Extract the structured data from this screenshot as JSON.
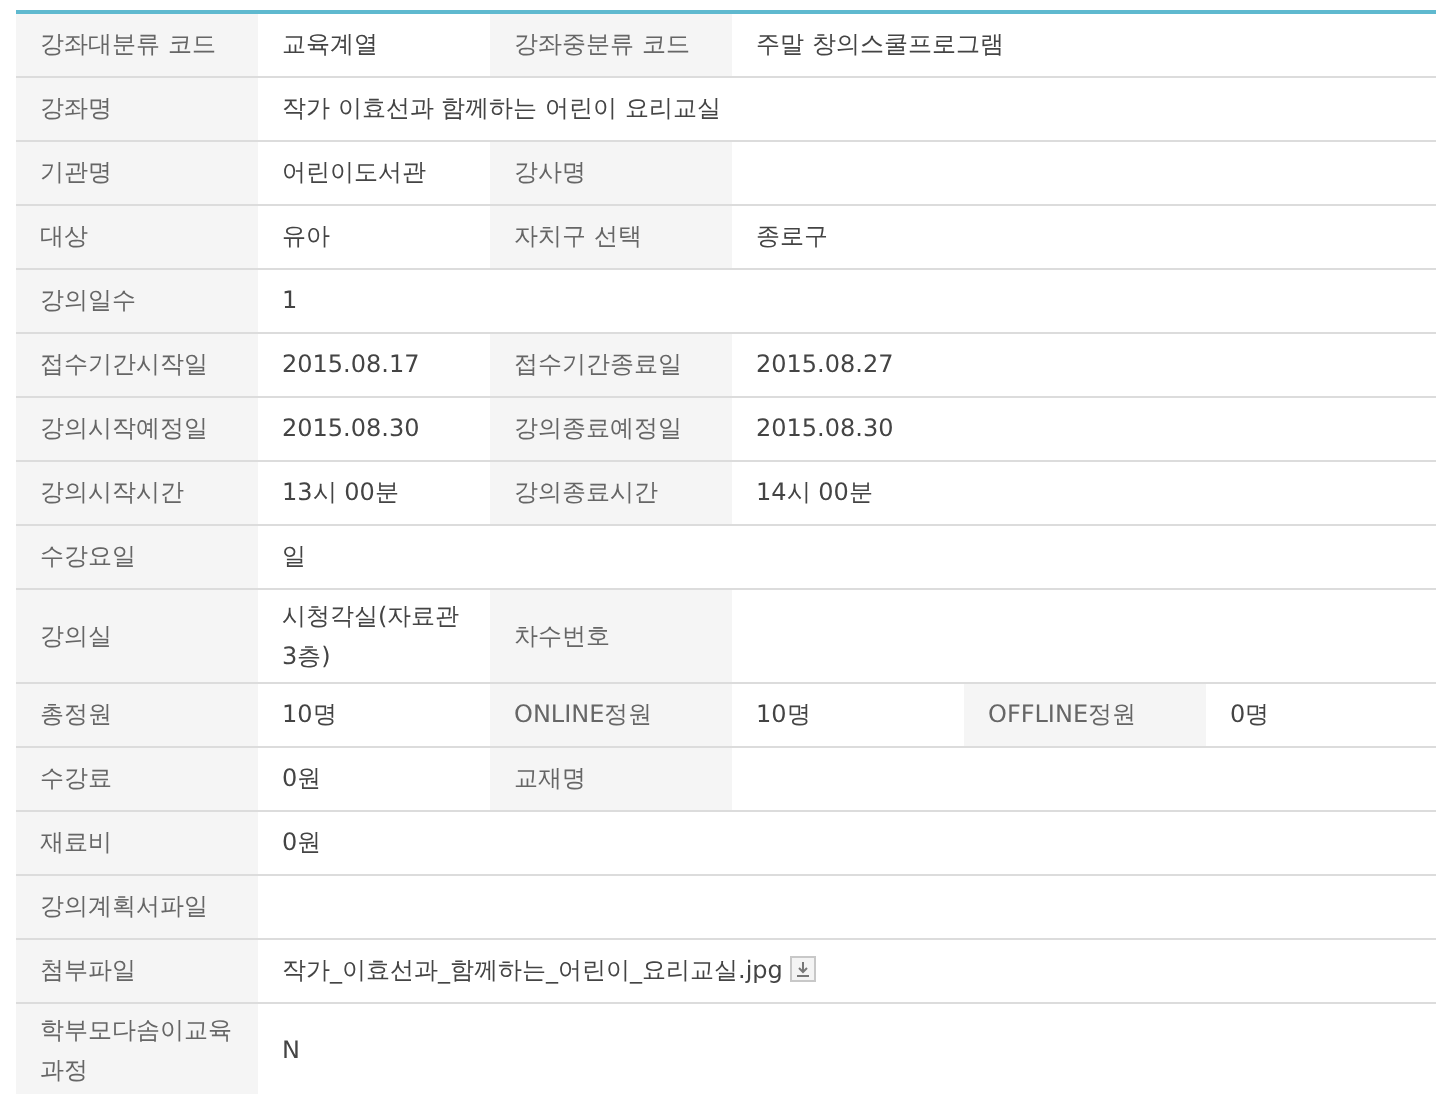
{
  "rows": [
    {
      "cells": [
        {
          "kind": "label",
          "text": "강좌대분류 코드"
        },
        {
          "kind": "value",
          "text": "교육계열"
        },
        {
          "kind": "label",
          "text": "강좌중분류 코드"
        },
        {
          "kind": "value",
          "text": "주말 창의스쿨프로그램"
        }
      ]
    },
    {
      "cells": [
        {
          "kind": "label",
          "text": "강좌명"
        },
        {
          "kind": "value",
          "text": "작가 이효선과 함께하는 어린이 요리교실"
        }
      ]
    },
    {
      "cells": [
        {
          "kind": "label",
          "text": "기관명"
        },
        {
          "kind": "value",
          "text": "어린이도서관"
        },
        {
          "kind": "label",
          "text": "강사명"
        },
        {
          "kind": "value",
          "text": ""
        }
      ]
    },
    {
      "cells": [
        {
          "kind": "label",
          "text": "대상"
        },
        {
          "kind": "value",
          "text": "유아"
        },
        {
          "kind": "label",
          "text": "자치구 선택"
        },
        {
          "kind": "value",
          "text": "종로구"
        }
      ]
    },
    {
      "cells": [
        {
          "kind": "label",
          "text": "강의일수"
        },
        {
          "kind": "value",
          "text": "1"
        }
      ]
    },
    {
      "cells": [
        {
          "kind": "label",
          "text": "접수기간시작일"
        },
        {
          "kind": "value",
          "text": "2015.08.17"
        },
        {
          "kind": "label",
          "text": "접수기간종료일"
        },
        {
          "kind": "value",
          "text": "2015.08.27"
        }
      ]
    },
    {
      "cells": [
        {
          "kind": "label",
          "text": "강의시작예정일"
        },
        {
          "kind": "value",
          "text": "2015.08.30"
        },
        {
          "kind": "label",
          "text": "강의종료예정일"
        },
        {
          "kind": "value",
          "text": "2015.08.30"
        }
      ]
    },
    {
      "cells": [
        {
          "kind": "label",
          "text": "강의시작시간"
        },
        {
          "kind": "value",
          "text": "13시 00분"
        },
        {
          "kind": "label",
          "text": "강의종료시간"
        },
        {
          "kind": "value",
          "text": "14시 00분"
        }
      ]
    },
    {
      "cells": [
        {
          "kind": "label",
          "text": "수강요일"
        },
        {
          "kind": "value",
          "text": "일"
        }
      ]
    },
    {
      "cells": [
        {
          "kind": "label",
          "text": "강의실"
        },
        {
          "kind": "value",
          "text": "시청각실(자료관3층)"
        },
        {
          "kind": "label",
          "text": "차수번호"
        },
        {
          "kind": "value",
          "text": ""
        }
      ]
    },
    {
      "cells": [
        {
          "kind": "label",
          "text": "총정원"
        },
        {
          "kind": "value",
          "text": "10명"
        },
        {
          "kind": "label",
          "text": "ONLINE정원"
        },
        {
          "kind": "value",
          "text": "10명"
        },
        {
          "kind": "label",
          "text": "OFFLINE정원"
        },
        {
          "kind": "value",
          "text": "0명"
        }
      ]
    },
    {
      "cells": [
        {
          "kind": "label",
          "text": "수강료"
        },
        {
          "kind": "value",
          "text": "0원"
        },
        {
          "kind": "label",
          "text": "교재명"
        },
        {
          "kind": "value",
          "text": ""
        }
      ]
    },
    {
      "cells": [
        {
          "kind": "label",
          "text": "재료비"
        },
        {
          "kind": "value",
          "text": "0원"
        }
      ]
    },
    {
      "cells": [
        {
          "kind": "label",
          "text": "강의계획서파일"
        },
        {
          "kind": "value",
          "text": ""
        }
      ]
    },
    {
      "cells": [
        {
          "kind": "label",
          "text": "첨부파일"
        },
        {
          "kind": "file",
          "text": "작가_이효선과_함께하는_어린이_요리교실.jpg"
        }
      ]
    },
    {
      "cells": [
        {
          "kind": "label",
          "text": "학부모다솜이교육과정"
        },
        {
          "kind": "value",
          "text": "N"
        }
      ]
    }
  ]
}
